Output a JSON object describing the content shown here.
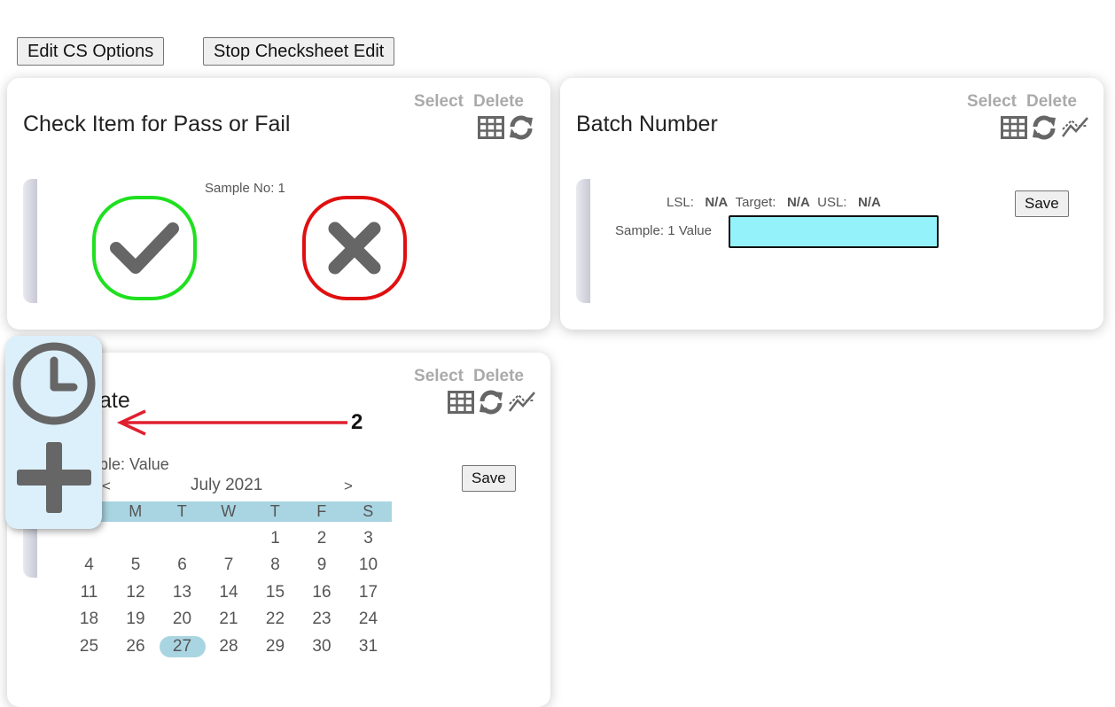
{
  "toolbar": {
    "edit_cs_options": "Edit CS Options",
    "stop_checksheet_edit": "Stop Checksheet Edit"
  },
  "cards": {
    "pass_fail": {
      "title": "Check Item for Pass or Fail",
      "select": "Select",
      "delete": "Delete",
      "sample_label": "Sample No: 1",
      "pass_color": "#1fe01f",
      "fail_color": "#e01010"
    },
    "batch": {
      "title": "Batch Number",
      "select": "Select",
      "delete": "Delete",
      "lsl_label": "LSL:",
      "lsl_value": "N/A",
      "target_label": "Target:",
      "target_value": "N/A",
      "usl_label": "USL:",
      "usl_value": "N/A",
      "sample_label": "Sample: 1 Value",
      "input_value": "",
      "input_color": "#94f2fb",
      "save": "Save"
    },
    "date": {
      "title_visible": "ate",
      "select": "Select",
      "delete": "Delete",
      "sample_label_visible": "ple: Value",
      "save": "Save",
      "calendar": {
        "prev": "<",
        "next": ">",
        "month": "July 2021",
        "weekdays_visible": [
          "M",
          "T",
          "W",
          "T",
          "F",
          "S"
        ],
        "weeks": [
          [
            "",
            "",
            "",
            "",
            "1",
            "2",
            "3"
          ],
          [
            "4",
            "5",
            "6",
            "7",
            "8",
            "9",
            "10"
          ],
          [
            "11",
            "12",
            "13",
            "14",
            "15",
            "16",
            "17"
          ],
          [
            "18",
            "19",
            "20",
            "21",
            "22",
            "23",
            "24"
          ],
          [
            "25",
            "26",
            "27",
            "28",
            "29",
            "30",
            "31"
          ]
        ],
        "selected": "27"
      }
    }
  },
  "floater": {
    "icons": [
      "clock-icon",
      "plus-icon"
    ]
  },
  "annotation": {
    "number": "2",
    "arrow_color": "#e02030"
  }
}
